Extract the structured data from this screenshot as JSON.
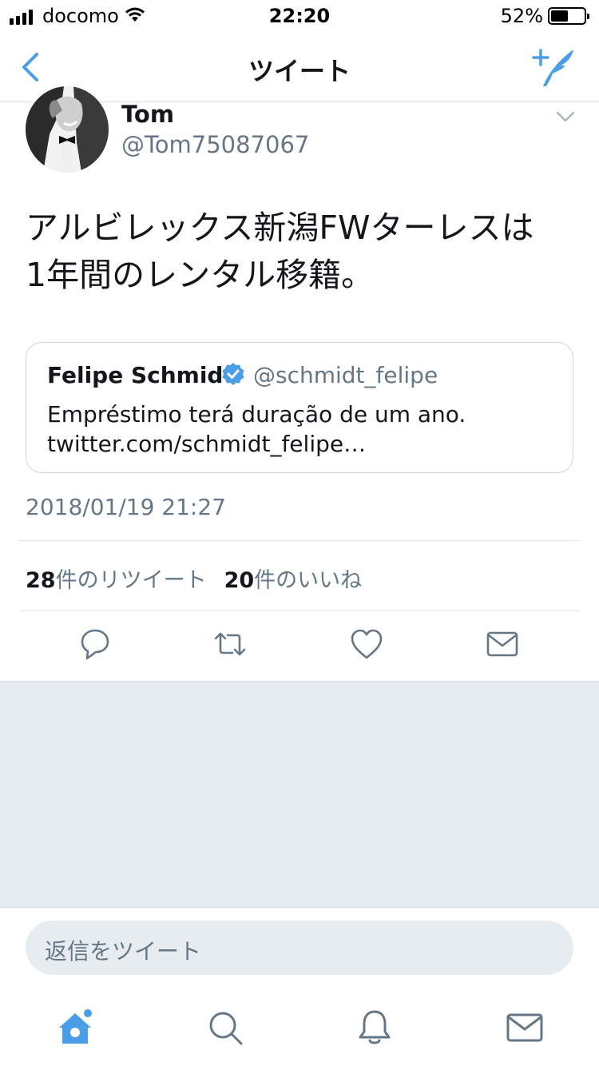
{
  "status_bar": {
    "carrier": "docomo",
    "time": "22:20",
    "battery_percent": "52%",
    "battery_level": 0.52
  },
  "nav": {
    "title": "ツイート",
    "back_icon": "chevron-left-icon",
    "compose_icon": "compose-tweet-icon"
  },
  "tweet": {
    "author_name": "Tom",
    "author_handle": "@Tom75087067",
    "text_line1": "アルビレックス新潟FWターレスは",
    "text_line2": "1年間のレンタル移籍。",
    "timestamp": "2018/01/19 21:27",
    "retweet_count": "28",
    "retweet_label": "件のリツイート",
    "like_count": "20",
    "like_label": "件のいいね"
  },
  "quote": {
    "name": "Felipe Schmidt",
    "handle": "@schmidt_felipe",
    "text": "Empréstimo terá duração de um ano.",
    "link": "twitter.com/schmidt_felipe…",
    "verified_icon": "verified-badge-icon"
  },
  "actions": [
    "reply-icon",
    "retweet-icon",
    "like-icon",
    "direct-message-icon"
  ],
  "reply": {
    "placeholder": "返信をツイート"
  },
  "tabbar": [
    "home-icon",
    "search-icon",
    "notifications-icon",
    "messages-icon"
  ],
  "colors": {
    "accent": "#4a9ee6",
    "text": "#14171a",
    "secondary": "#657786",
    "background_gray": "#e6ecf0"
  }
}
